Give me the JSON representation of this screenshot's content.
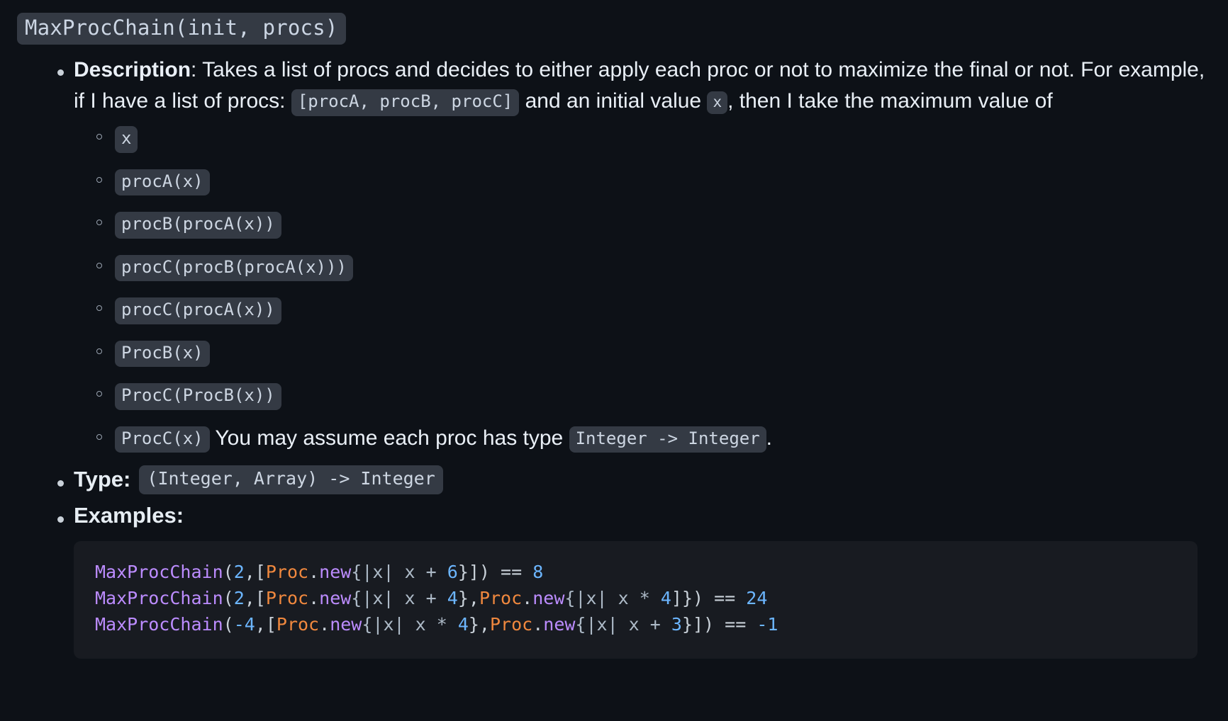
{
  "heading": {
    "signature": "MaxProcChain(init, procs)"
  },
  "description": {
    "label": "Description",
    "text_1": ": Takes a list of procs and decides to either apply each proc or not to maximize the final or not. For example, if I have a list of procs:",
    "procs_list": "[procA, procB, procC]",
    "text_2": "and an initial value",
    "initial_value": "x",
    "text_3": ", then I take the maximum value of",
    "candidates": [
      "x",
      "procA(x)",
      "procB(procA(x))",
      "procC(procB(procA(x)))",
      "procC(procA(x))",
      "ProcB(x)",
      "ProcC(ProcB(x))",
      "ProcC(x)"
    ],
    "assume_text": "You may assume each proc has type",
    "proc_type": "Integer -> Integer",
    "assume_period": "."
  },
  "type_section": {
    "label": "Type:",
    "signature": "(Integer, Array) -> Integer"
  },
  "examples_section": {
    "label": "Examples:",
    "lines": [
      [
        {
          "t": "MaxProcChain",
          "c": "fn"
        },
        {
          "t": "(",
          "c": "punct"
        },
        {
          "t": "2",
          "c": "num"
        },
        {
          "t": ",[",
          "c": "punct"
        },
        {
          "t": "Proc",
          "c": "cls"
        },
        {
          "t": ".",
          "c": "punct"
        },
        {
          "t": "new",
          "c": "fn"
        },
        {
          "t": "{|x| x + ",
          "c": "var"
        },
        {
          "t": "6",
          "c": "num"
        },
        {
          "t": "}])",
          "c": "punct"
        },
        {
          "t": " == ",
          "c": "op"
        },
        {
          "t": "8",
          "c": "num"
        }
      ],
      [
        {
          "t": "MaxProcChain",
          "c": "fn"
        },
        {
          "t": "(",
          "c": "punct"
        },
        {
          "t": "2",
          "c": "num"
        },
        {
          "t": ",[",
          "c": "punct"
        },
        {
          "t": "Proc",
          "c": "cls"
        },
        {
          "t": ".",
          "c": "punct"
        },
        {
          "t": "new",
          "c": "fn"
        },
        {
          "t": "{|x| x + ",
          "c": "var"
        },
        {
          "t": "4",
          "c": "num"
        },
        {
          "t": "},",
          "c": "punct"
        },
        {
          "t": "Proc",
          "c": "cls"
        },
        {
          "t": ".",
          "c": "punct"
        },
        {
          "t": "new",
          "c": "fn"
        },
        {
          "t": "{|x| x * ",
          "c": "var"
        },
        {
          "t": "4",
          "c": "num"
        },
        {
          "t": "]})",
          "c": "punct"
        },
        {
          "t": " == ",
          "c": "op"
        },
        {
          "t": "24",
          "c": "num"
        }
      ],
      [
        {
          "t": "MaxProcChain",
          "c": "fn"
        },
        {
          "t": "(",
          "c": "punct"
        },
        {
          "t": "-4",
          "c": "num"
        },
        {
          "t": ",[",
          "c": "punct"
        },
        {
          "t": "Proc",
          "c": "cls"
        },
        {
          "t": ".",
          "c": "punct"
        },
        {
          "t": "new",
          "c": "fn"
        },
        {
          "t": "{|x| x * ",
          "c": "var"
        },
        {
          "t": "4",
          "c": "num"
        },
        {
          "t": "},",
          "c": "punct"
        },
        {
          "t": "Proc",
          "c": "cls"
        },
        {
          "t": ".",
          "c": "punct"
        },
        {
          "t": "new",
          "c": "fn"
        },
        {
          "t": "{|x| x + ",
          "c": "var"
        },
        {
          "t": "3",
          "c": "num"
        },
        {
          "t": "}])",
          "c": "punct"
        },
        {
          "t": " == ",
          "c": "op"
        },
        {
          "t": "-1",
          "c": "num"
        }
      ]
    ]
  },
  "colors": {
    "page_bg": "#0d1117",
    "code_block_bg": "#181b21",
    "chip_bg": "#343a44",
    "text": "#e9eff6",
    "fn": "#bc8cff",
    "num": "#6cb6ff",
    "cls": "#f0883e"
  }
}
